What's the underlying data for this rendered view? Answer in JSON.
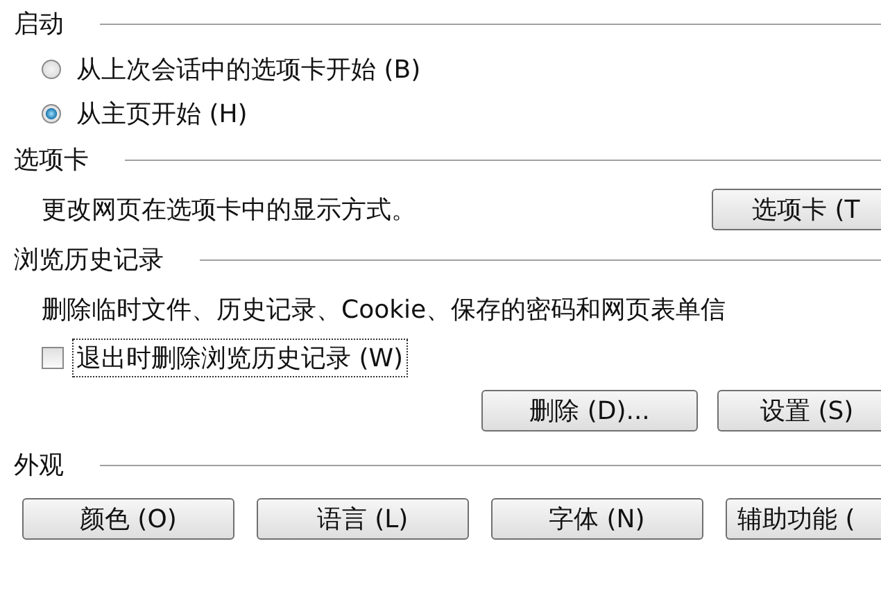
{
  "sections": [
    {
      "title": "启动",
      "items": [
        {
          "kind": "radio",
          "label": "从上次会话中的选项卡开始 (B)",
          "selected": false
        },
        {
          "kind": "radio",
          "label": "从主页开始 (H)",
          "selected": true
        }
      ]
    },
    {
      "title": "选项卡",
      "items": [
        {
          "kind": "text_button",
          "text": "更改网页在选项卡中的显示方式。",
          "button": "选项卡 (T"
        }
      ]
    },
    {
      "title": "浏览历史记录",
      "items": [
        {
          "kind": "text",
          "text": "删除临时文件、历史记录、Cookie、保存的密码和网页表单信"
        },
        {
          "kind": "checkbox",
          "label": "退出时删除浏览历史记录 (W)",
          "checked": false,
          "focused": true
        },
        {
          "kind": "buttons",
          "buttons": [
            "删除 (D)...",
            "设置 (S)"
          ]
        }
      ]
    },
    {
      "title": "外观",
      "items": [
        {
          "kind": "buttons",
          "buttons": [
            "颜色 (O)",
            "语言 (L)",
            "字体 (N)",
            "辅助功能 ("
          ]
        }
      ]
    }
  ]
}
